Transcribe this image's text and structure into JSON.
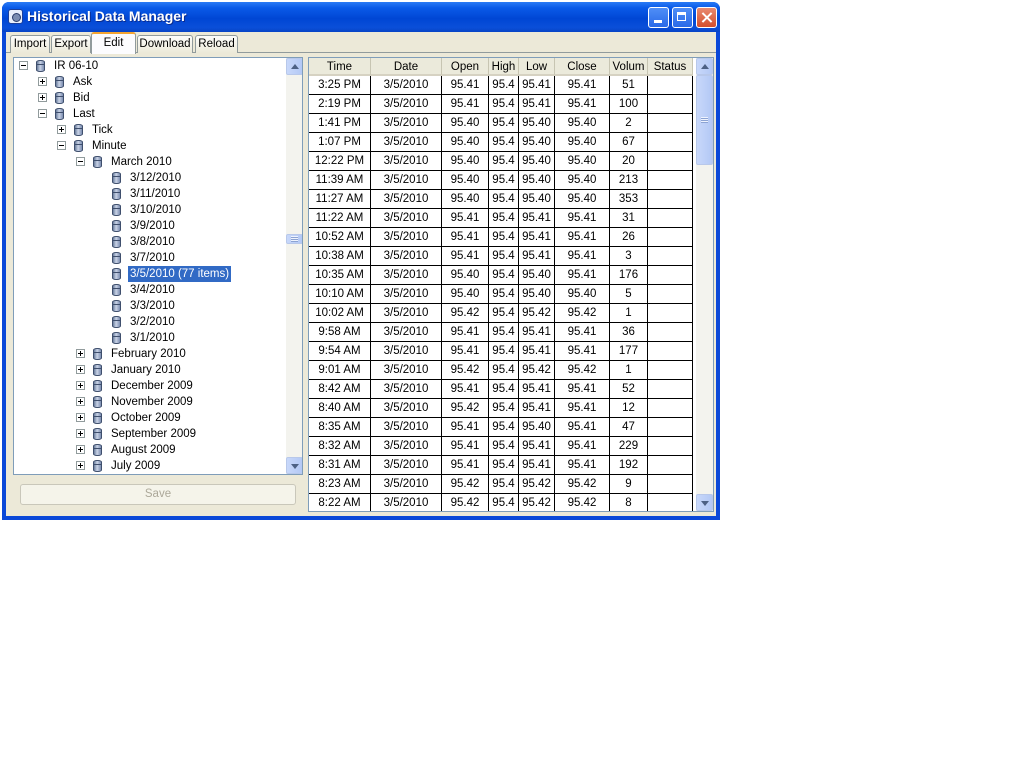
{
  "window": {
    "title": "Historical Data Manager"
  },
  "tabs": [
    {
      "label": "Import",
      "active": false
    },
    {
      "label": "Export",
      "active": false
    },
    {
      "label": "Edit",
      "active": true
    },
    {
      "label": "Download",
      "active": false
    },
    {
      "label": "Reload",
      "active": false
    }
  ],
  "tree": {
    "nodes": [
      {
        "label": "IR 06-10",
        "depth": 0,
        "expander": "minus",
        "icon": "database-icon"
      },
      {
        "label": "Ask",
        "depth": 1,
        "expander": "plus",
        "icon": "database-icon"
      },
      {
        "label": "Bid",
        "depth": 1,
        "expander": "plus",
        "icon": "database-icon"
      },
      {
        "label": "Last",
        "depth": 1,
        "expander": "minus",
        "icon": "database-icon"
      },
      {
        "label": "Tick",
        "depth": 2,
        "expander": "plus",
        "icon": "database-icon"
      },
      {
        "label": "Minute",
        "depth": 2,
        "expander": "minus",
        "icon": "database-icon"
      },
      {
        "label": "March 2010",
        "depth": 3,
        "expander": "minus",
        "icon": "database-icon"
      },
      {
        "label": "3/12/2010",
        "depth": 4,
        "expander": "none",
        "icon": "database-icon"
      },
      {
        "label": "3/11/2010",
        "depth": 4,
        "expander": "none",
        "icon": "database-icon"
      },
      {
        "label": "3/10/2010",
        "depth": 4,
        "expander": "none",
        "icon": "database-icon"
      },
      {
        "label": "3/9/2010",
        "depth": 4,
        "expander": "none",
        "icon": "database-icon"
      },
      {
        "label": "3/8/2010",
        "depth": 4,
        "expander": "none",
        "icon": "database-icon"
      },
      {
        "label": "3/7/2010",
        "depth": 4,
        "expander": "none",
        "icon": "database-icon"
      },
      {
        "label": "3/5/2010 (77 items)",
        "depth": 4,
        "expander": "none",
        "icon": "database-icon",
        "selected": true
      },
      {
        "label": "3/4/2010",
        "depth": 4,
        "expander": "none",
        "icon": "database-icon"
      },
      {
        "label": "3/3/2010",
        "depth": 4,
        "expander": "none",
        "icon": "database-icon"
      },
      {
        "label": "3/2/2010",
        "depth": 4,
        "expander": "none",
        "icon": "database-icon"
      },
      {
        "label": "3/1/2010",
        "depth": 4,
        "expander": "none",
        "icon": "database-icon"
      },
      {
        "label": "February 2010",
        "depth": 3,
        "expander": "plus",
        "icon": "database-icon"
      },
      {
        "label": "January 2010",
        "depth": 3,
        "expander": "plus",
        "icon": "database-icon"
      },
      {
        "label": "December 2009",
        "depth": 3,
        "expander": "plus",
        "icon": "database-icon"
      },
      {
        "label": "November 2009",
        "depth": 3,
        "expander": "plus",
        "icon": "database-icon"
      },
      {
        "label": "October 2009",
        "depth": 3,
        "expander": "plus",
        "icon": "database-icon"
      },
      {
        "label": "September 2009",
        "depth": 3,
        "expander": "plus",
        "icon": "database-icon"
      },
      {
        "label": "August 2009",
        "depth": 3,
        "expander": "plus",
        "icon": "database-icon"
      },
      {
        "label": "July 2009",
        "depth": 3,
        "expander": "plus",
        "icon": "database-icon"
      }
    ]
  },
  "save_button": {
    "label": "Save",
    "enabled": false
  },
  "grid": {
    "columns": [
      "Time",
      "Date",
      "Open",
      "High",
      "Low",
      "Close",
      "Volum",
      "Status"
    ],
    "rows": [
      [
        "3:25 PM",
        "3/5/2010",
        "95.41",
        "95.4",
        "95.41",
        "95.41",
        "51",
        ""
      ],
      [
        "2:19 PM",
        "3/5/2010",
        "95.41",
        "95.4",
        "95.41",
        "95.41",
        "100",
        ""
      ],
      [
        "1:41 PM",
        "3/5/2010",
        "95.40",
        "95.4",
        "95.40",
        "95.40",
        "2",
        ""
      ],
      [
        "1:07 PM",
        "3/5/2010",
        "95.40",
        "95.4",
        "95.40",
        "95.40",
        "67",
        ""
      ],
      [
        "12:22 PM",
        "3/5/2010",
        "95.40",
        "95.4",
        "95.40",
        "95.40",
        "20",
        ""
      ],
      [
        "11:39 AM",
        "3/5/2010",
        "95.40",
        "95.4",
        "95.40",
        "95.40",
        "213",
        ""
      ],
      [
        "11:27 AM",
        "3/5/2010",
        "95.40",
        "95.4",
        "95.40",
        "95.40",
        "353",
        ""
      ],
      [
        "11:22 AM",
        "3/5/2010",
        "95.41",
        "95.4",
        "95.41",
        "95.41",
        "31",
        ""
      ],
      [
        "10:52 AM",
        "3/5/2010",
        "95.41",
        "95.4",
        "95.41",
        "95.41",
        "26",
        ""
      ],
      [
        "10:38 AM",
        "3/5/2010",
        "95.41",
        "95.4",
        "95.41",
        "95.41",
        "3",
        ""
      ],
      [
        "10:35 AM",
        "3/5/2010",
        "95.40",
        "95.4",
        "95.40",
        "95.41",
        "176",
        ""
      ],
      [
        "10:10 AM",
        "3/5/2010",
        "95.40",
        "95.4",
        "95.40",
        "95.40",
        "5",
        ""
      ],
      [
        "10:02 AM",
        "3/5/2010",
        "95.42",
        "95.4",
        "95.42",
        "95.42",
        "1",
        ""
      ],
      [
        "9:58 AM",
        "3/5/2010",
        "95.41",
        "95.4",
        "95.41",
        "95.41",
        "36",
        ""
      ],
      [
        "9:54 AM",
        "3/5/2010",
        "95.41",
        "95.4",
        "95.41",
        "95.41",
        "177",
        ""
      ],
      [
        "9:01 AM",
        "3/5/2010",
        "95.42",
        "95.4",
        "95.42",
        "95.42",
        "1",
        ""
      ],
      [
        "8:42 AM",
        "3/5/2010",
        "95.41",
        "95.4",
        "95.41",
        "95.41",
        "52",
        ""
      ],
      [
        "8:40 AM",
        "3/5/2010",
        "95.42",
        "95.4",
        "95.41",
        "95.41",
        "12",
        ""
      ],
      [
        "8:35 AM",
        "3/5/2010",
        "95.41",
        "95.4",
        "95.40",
        "95.41",
        "47",
        ""
      ],
      [
        "8:32 AM",
        "3/5/2010",
        "95.41",
        "95.4",
        "95.41",
        "95.41",
        "229",
        ""
      ],
      [
        "8:31 AM",
        "3/5/2010",
        "95.41",
        "95.4",
        "95.41",
        "95.41",
        "192",
        ""
      ],
      [
        "8:23 AM",
        "3/5/2010",
        "95.42",
        "95.4",
        "95.42",
        "95.42",
        "9",
        ""
      ],
      [
        "8:22 AM",
        "3/5/2010",
        "95.42",
        "95.4",
        "95.42",
        "95.42",
        "8",
        ""
      ]
    ]
  }
}
